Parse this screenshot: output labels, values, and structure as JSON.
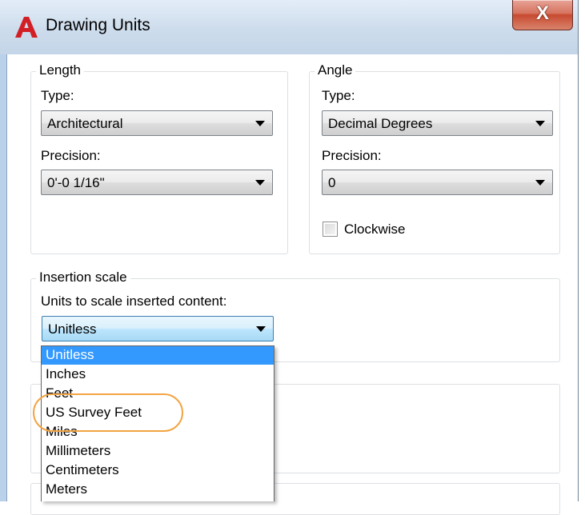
{
  "window": {
    "title": "Drawing Units",
    "close_label": "X",
    "logo_letter": "A"
  },
  "length": {
    "group_label": "Length",
    "type_label": "Type:",
    "type_value": "Architectural",
    "precision_label": "Precision:",
    "precision_value": "0'-0 1/16\""
  },
  "angle": {
    "group_label": "Angle",
    "type_label": "Type:",
    "type_value": "Decimal Degrees",
    "precision_label": "Precision:",
    "precision_value": "0",
    "clockwise_label": "Clockwise",
    "clockwise_checked": false
  },
  "insertion": {
    "group_label": "Insertion scale",
    "units_label": "Units to scale inserted content:",
    "units_value": "Unitless"
  },
  "dropdown": {
    "items": [
      "Unitless",
      "Inches",
      "Feet",
      "US Survey Feet",
      "Miles",
      "Millimeters",
      "Centimeters",
      "Meters"
    ],
    "selected_index": 0,
    "highlighted_item": "US Survey Feet"
  },
  "colors": {
    "selection": "#3399ff",
    "highlight_ring": "#f3a443",
    "logo_red": "#d21f26"
  }
}
